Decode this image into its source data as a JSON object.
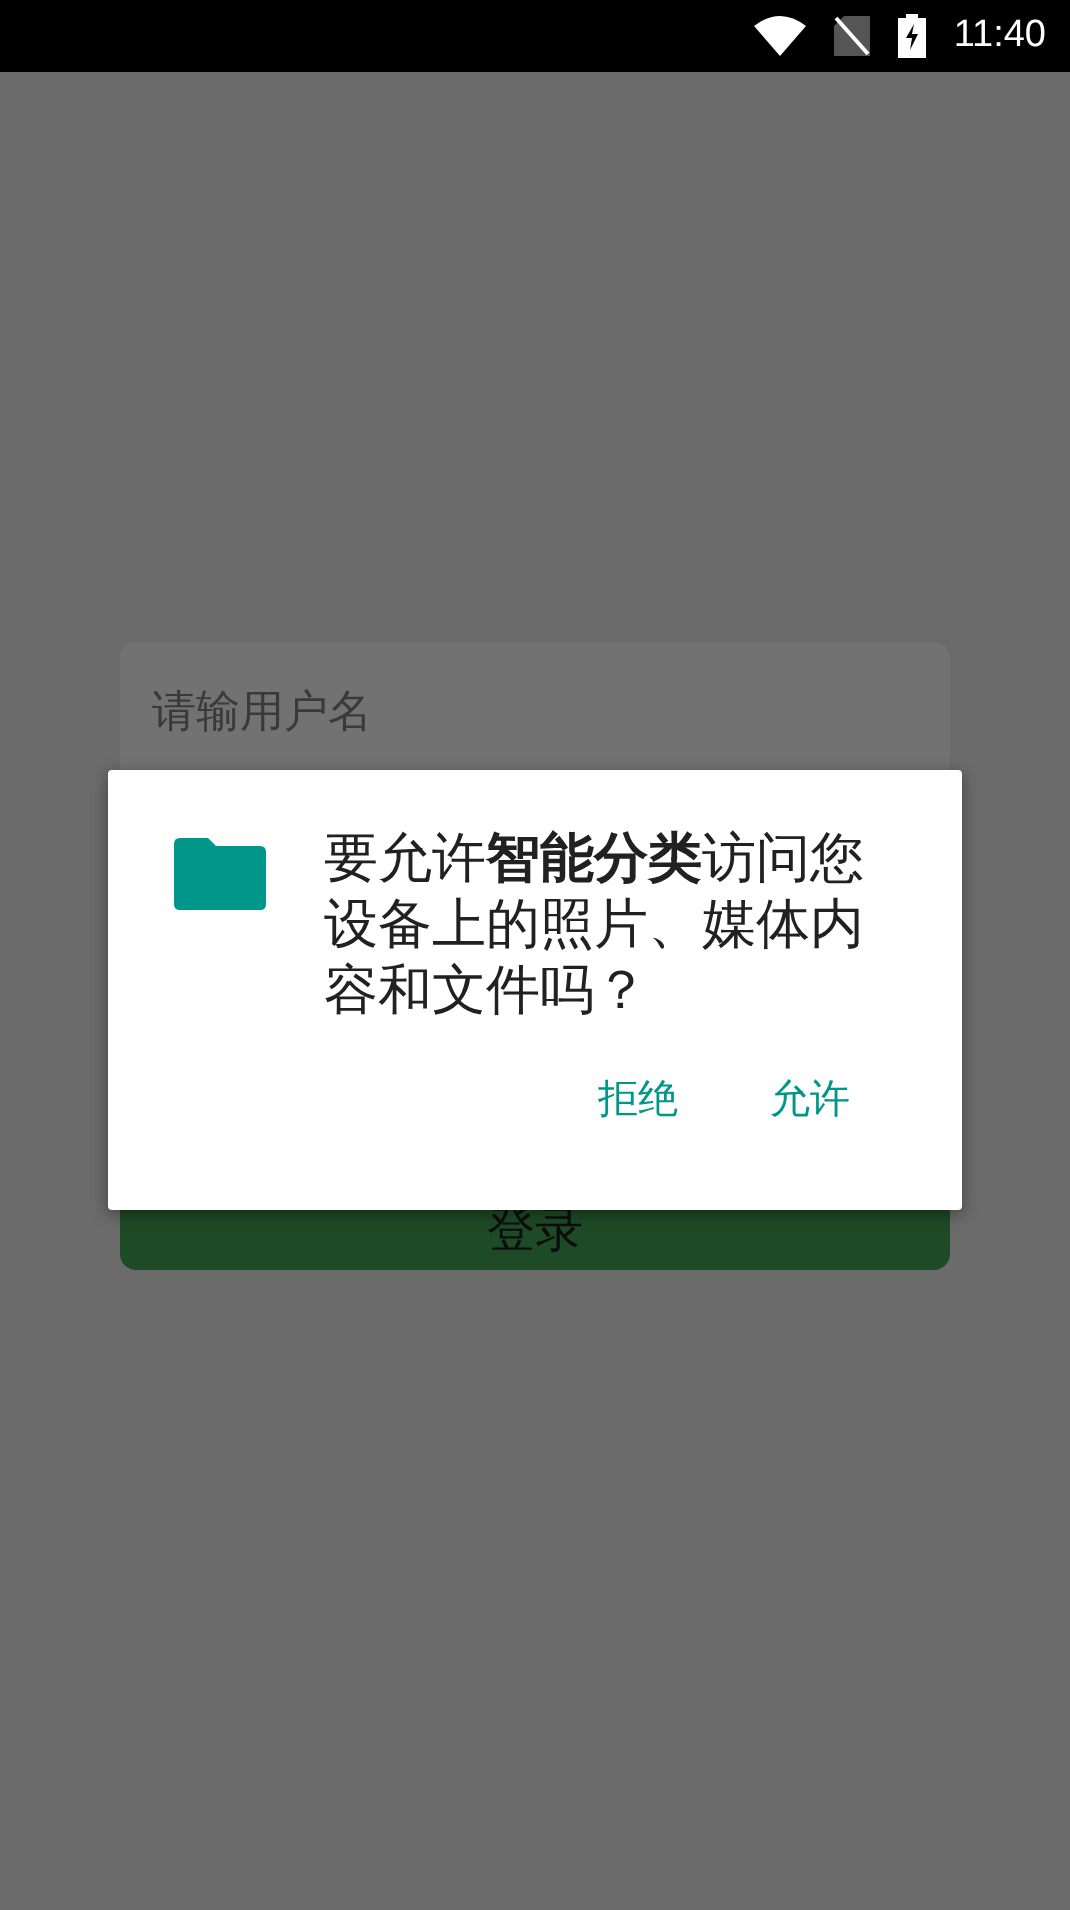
{
  "status_bar": {
    "time": "11:40"
  },
  "login_form": {
    "username": {
      "placeholder": "请输用户名"
    },
    "login_button": "登录"
  },
  "dialog": {
    "message": "要允许**智能分类**访问您设备上的照片、媒体内容和文件吗？",
    "buttons": [
      {
        "label": "拒绝"
      },
      {
        "label": "允许"
      }
    ]
  }
}
